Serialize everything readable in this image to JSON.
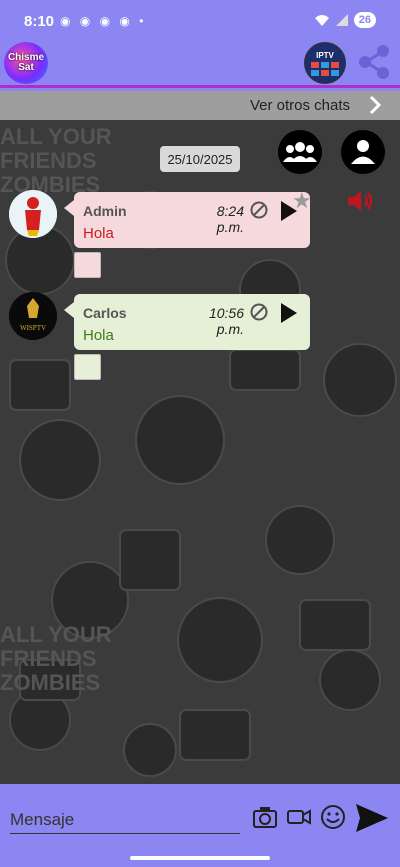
{
  "status_bar": {
    "time": "8:10",
    "battery": "26"
  },
  "app_bar": {
    "logo_text": "Chisme\nSat",
    "iptv_text": "IPTV",
    "share_icon": "share-icon"
  },
  "other_chats": {
    "label": "Ver otros chats"
  },
  "chat": {
    "date": "25/10/2025",
    "messages": [
      {
        "name": "Admin",
        "time": "8:24 p.m.",
        "text": "Hola",
        "bubble_color": "#f6d9dd",
        "text_color": "#c81e1e"
      },
      {
        "name": "Carlos",
        "time": "10:56 p.m.",
        "text": "Hola",
        "bubble_color": "#e6f0d6",
        "text_color": "#3f7d14"
      }
    ],
    "avatar2_text": "WISPTV"
  },
  "input": {
    "placeholder": "Mensaje"
  },
  "colors": {
    "accent": "#8c86f2",
    "divider": "#b02ec8",
    "speaker": "#c0141e"
  }
}
